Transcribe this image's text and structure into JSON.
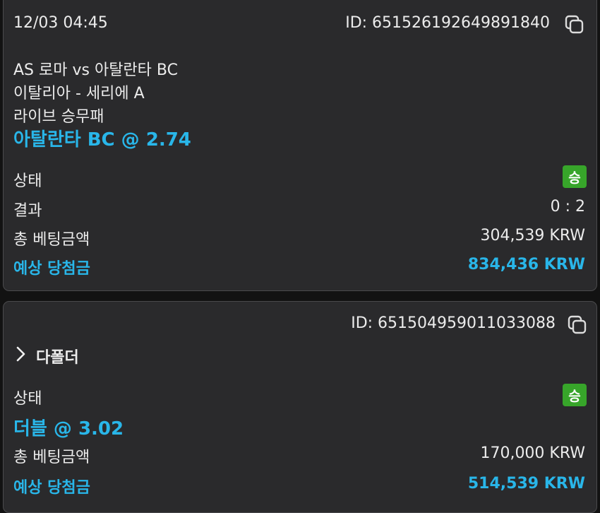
{
  "card1": {
    "datetime": "12/03 04:45",
    "id_text": "ID: 651526192649891840",
    "match": "AS 로마 vs 아탈란타 BC",
    "league": "이탈리아 - 세리에 A",
    "market": "라이브 승무패",
    "pick": "아탈란타 BC @ 2.74",
    "status_label": "상태",
    "status_badge": "승",
    "result_label": "결과",
    "result_value": "0 : 2",
    "stake_label": "총 베팅금액",
    "stake_value": "304,539 KRW",
    "payout_label": "예상 당첨금",
    "payout_value": "834,436 KRW"
  },
  "card2": {
    "id_text": "ID: 651504959011033088",
    "folder_label": "다폴더",
    "status_label": "상태",
    "status_badge": "승",
    "pick": "더블 @ 3.02",
    "stake_label": "총 베팅금액",
    "stake_value": "170,000 KRW",
    "payout_label": "예상 당첨금",
    "payout_value": "514,539 KRW"
  },
  "colors": {
    "accent_blue": "#29b6e9",
    "win_green": "#37a52a",
    "card_bg": "#2a2a2c"
  },
  "icons": {
    "copy": "copy-icon",
    "expand": "chevron-right-icon"
  }
}
